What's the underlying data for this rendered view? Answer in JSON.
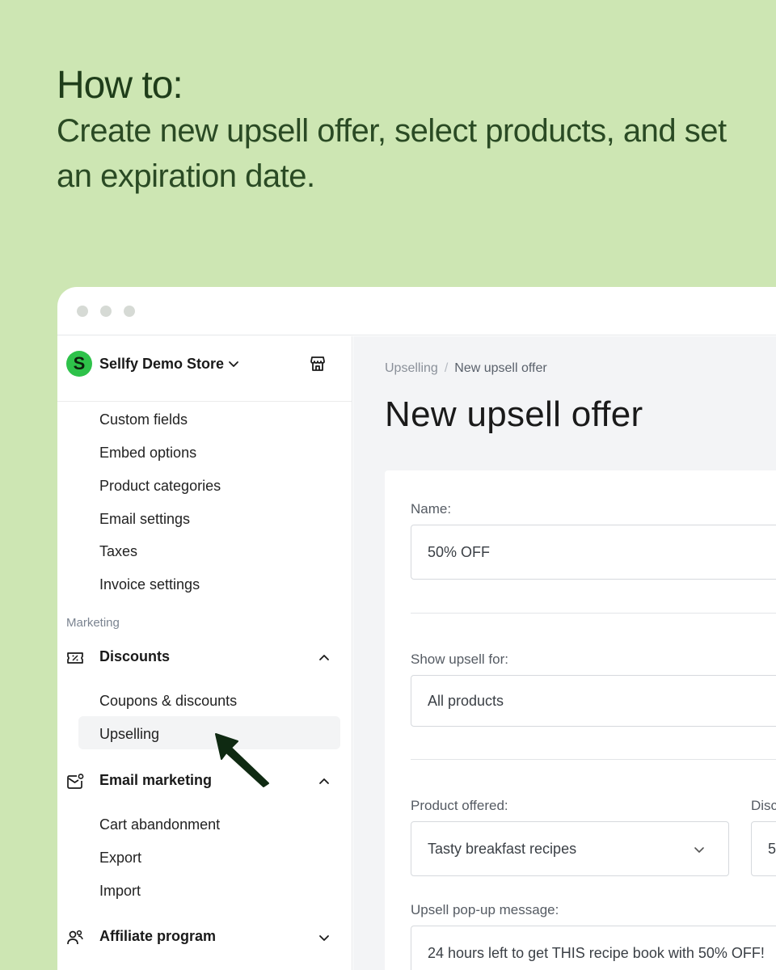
{
  "heading": {
    "title": "How to:",
    "subtitle": "Create new upsell offer, select products, and set an expiration date."
  },
  "store": {
    "logo_letter": "S",
    "name": "Sellfy Demo Store",
    "chevron_icon": "chevron-down-icon",
    "store_icon": "storefront-icon"
  },
  "sidebar": {
    "settings_items": [
      "Custom fields",
      "Embed options",
      "Product categories",
      "Email settings",
      "Taxes",
      "Invoice settings"
    ],
    "section_marketing": "Marketing",
    "discounts": {
      "label": "Discounts",
      "icon": "ticket-icon",
      "items": [
        "Coupons & discounts",
        "Upselling"
      ],
      "active_item": "Upselling"
    },
    "email_marketing": {
      "label": "Email marketing",
      "icon": "mail-notification-icon",
      "items": [
        "Cart abandonment",
        "Export",
        "Import"
      ]
    },
    "affiliate": {
      "label": "Affiliate program",
      "icon": "affiliate-users-icon"
    }
  },
  "main": {
    "breadcrumb": {
      "parent": "Upselling",
      "separator": "/",
      "current": "New upsell offer"
    },
    "title": "New upsell offer",
    "form": {
      "name_label": "Name:",
      "name_value": "50% OFF",
      "show_for_label": "Show upsell for:",
      "show_for_value": "All products",
      "product_offered_label": "Product offered:",
      "product_offered_value": "Tasty breakfast recipes",
      "discount_label": "Disc",
      "discount_value": "5",
      "message_label": "Upsell pop-up message:",
      "message_value": "24 hours left to get THIS recipe book with 50% OFF!"
    }
  },
  "colors": {
    "background": "#cde6b3",
    "brand_green": "#2ec24a",
    "heading_text": "#1f3d1a",
    "cursor": "#0f2a12"
  }
}
